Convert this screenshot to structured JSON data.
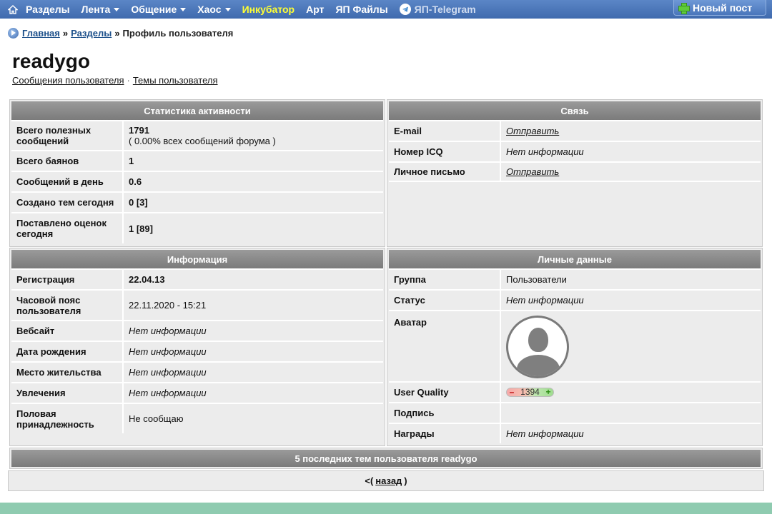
{
  "nav": {
    "items": [
      {
        "label": "Разделы",
        "caret": false,
        "style": ""
      },
      {
        "label": "Лента",
        "caret": true,
        "style": ""
      },
      {
        "label": "Общение",
        "caret": true,
        "style": ""
      },
      {
        "label": "Хаос",
        "caret": true,
        "style": ""
      },
      {
        "label": "Инкубатор",
        "caret": false,
        "style": "hl"
      },
      {
        "label": "Арт",
        "caret": false,
        "style": ""
      },
      {
        "label": "ЯП Файлы",
        "caret": false,
        "style": ""
      }
    ],
    "telegram": "ЯП-Telegram",
    "new_post": "Новый пост",
    "home_icon": "home-icon"
  },
  "breadcrumb": {
    "home": "Главная",
    "sections": "Разделы",
    "sep": "»",
    "current": "Профиль пользователя"
  },
  "user": {
    "name": "readygo",
    "posts_link": "Сообщения пользователя",
    "links_sep": "·",
    "topics_link": "Темы пользователя"
  },
  "activity": {
    "title": "Статистика активности",
    "rows": [
      {
        "k": "Всего полезных сообщений",
        "v": "1791",
        "v2": "( 0.00% всех сообщений форума )"
      },
      {
        "k": "Всего баянов",
        "v": "1"
      },
      {
        "k": "Сообщений в день",
        "v": "0.6"
      },
      {
        "k": "Создано тем сегодня",
        "v": "0 [3]"
      },
      {
        "k": "Поставлено оценок сегодня",
        "v": "1 [89]"
      }
    ]
  },
  "contact": {
    "title": "Связь",
    "rows": [
      {
        "k": "E-mail",
        "v": "Отправить",
        "link": true
      },
      {
        "k": "Номер ICQ",
        "v": "Нет информации",
        "link": false
      },
      {
        "k": "Личное письмо",
        "v": "Отправить",
        "link": true
      }
    ]
  },
  "info": {
    "title": "Информация",
    "rows": [
      {
        "k": "Регистрация",
        "v": "22.04.13",
        "style": "b"
      },
      {
        "k": "Часовой пояс пользователя",
        "v": "22.11.2020 - 15:21",
        "style": ""
      },
      {
        "k": "Вебсайт",
        "v": "Нет информации",
        "style": "i"
      },
      {
        "k": "Дата рождения",
        "v": "Нет информации",
        "style": "i"
      },
      {
        "k": "Место жительства",
        "v": "Нет информации",
        "style": "i"
      },
      {
        "k": "Увлечения",
        "v": "Нет информации",
        "style": "i"
      },
      {
        "k": "Половая принадлежность",
        "v": "Не сообщаю",
        "style": ""
      }
    ]
  },
  "personal": {
    "title": "Личные данные",
    "group_label": "Группа",
    "group": "Пользователи",
    "status_label": "Статус",
    "status": "Нет информации",
    "avatar_label": "Аватар",
    "uq_label": "User Quality",
    "uq_minus": "–",
    "uq_value": "1394",
    "uq_plus": "+",
    "signature_label": "Подпись",
    "signature": "",
    "awards_label": "Награды",
    "awards": "Нет информации"
  },
  "recent": {
    "title": "5 последних тем пользователя readygo"
  },
  "back": {
    "prefix": "<(",
    "link": "назад",
    "suffix": ")"
  },
  "colors": {
    "nav": "#4a76bb",
    "highlight": "#ffff33",
    "panel_head": "#8a8a8a",
    "footer": "#8fcbb0"
  }
}
